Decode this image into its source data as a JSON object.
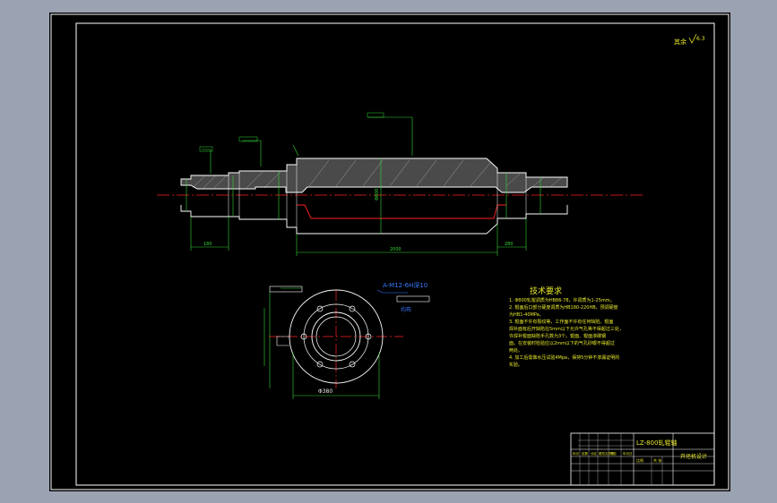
{
  "drawing": {
    "roughness_note": "其余",
    "roughness_value": "6.3",
    "top_dimensions": {
      "left_shaft_length": "180",
      "body_length": "2000",
      "right_shaft_length": "280",
      "center_diameter": "Φ800"
    },
    "section_label": "A-M12-6H深10",
    "section_tag": "均布",
    "section_dimension": "Φ380"
  },
  "tech_requirements": {
    "title": "技术要求",
    "lines": [
      "1. Φ800轧辊调质为HB86-78，许调质为1-25mm。",
      "2. 辊面后口部分硬度调质为HB180-220HB，预调硬度",
      "为HB1-40MPa。",
      "3. 辊面不许有裂纹等，工作面不许有任何缺陷。辊面",
      "焊补面有后开缺陷在5mm以下允许气孔等不得超过三处，",
      "许焊补辊面缺陷手孔数为3个。辊面、辊面渗碳钢",
      "面。在安装时检验应以2mm以下的气孔砂眼不得超过",
      "两处。",
      "4. 加工后需做水压试验4Mpa，保持5分钟不渗漏证明的",
      "实验。"
    ]
  },
  "title_block": {
    "drawing_name": "LZ-800轧辊轴",
    "design_title": "开坯机设计",
    "small_labels": [
      "标记",
      "处数",
      "分区",
      "更改文件号",
      "签名",
      "年月日"
    ],
    "scale_label": "比例",
    "sheet_label": "共 张"
  },
  "colors": {
    "background": "#000000",
    "outline": "#ffffff",
    "dimension": "#35d435",
    "text": "#e8e82a",
    "center_line": "#ff2020",
    "annotation": "#3a7bff"
  }
}
